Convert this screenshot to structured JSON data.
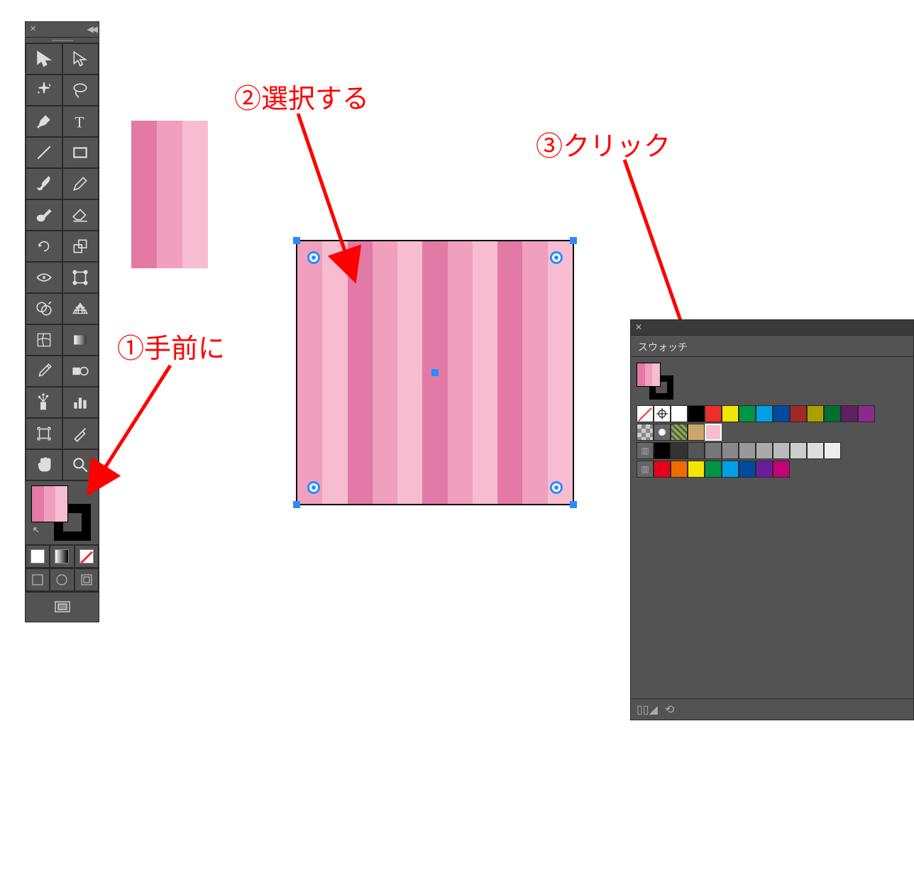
{
  "annotations": {
    "a1": {
      "num": "①",
      "text": "手前に"
    },
    "a2": {
      "num": "②",
      "text": "選択する"
    },
    "a3": {
      "num": "③",
      "text": "クリック"
    }
  },
  "swatches": {
    "tab_label": "スウォッチ"
  },
  "pattern_colors": {
    "stripe1": "#e27aa5",
    "stripe2": "#f09fbf",
    "stripe3": "#f7bcd0"
  },
  "swatch_colors_row1": [
    "#ee2e2a",
    "#ef6b00",
    "#f3e500",
    "#009540",
    "#00a0e6",
    "#2e3192",
    "#8b2a8e"
  ],
  "swatch_colors_row1b": [
    "#a22828",
    "#aa5500",
    "#a9a000",
    "#006f2f",
    "#0070a0",
    "#1f2266",
    "#5f1f61"
  ],
  "grays": [
    "#000",
    "#333",
    "#555",
    "#777",
    "#999",
    "#bbb",
    "#ddd",
    "#fff"
  ],
  "brights": [
    "#e6001f",
    "#ef6b00",
    "#f3e500",
    "#009540",
    "#00a0e6",
    "#004a9f",
    "#6a1e9c",
    "#c4007a"
  ]
}
